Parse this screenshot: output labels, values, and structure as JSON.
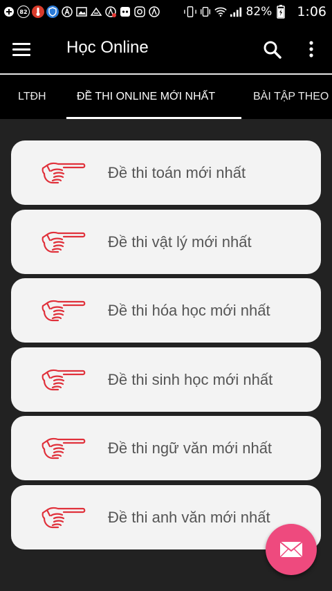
{
  "status_bar": {
    "notification_count": "82",
    "battery_percent": "82%",
    "time": "1:06",
    "icons_left": [
      "add-icon",
      "notification-count-icon",
      "thermometer-icon",
      "shield-icon",
      "app-a-icon",
      "image-icon",
      "mail-icon",
      "app-a-badge-icon",
      "gamepad-icon",
      "instagram-icon",
      "app-a2-icon"
    ],
    "icons_right": [
      "phone-rotate-icon",
      "vibrate-icon",
      "wifi-icon",
      "signal-icon",
      "battery-charging-icon"
    ]
  },
  "toolbar": {
    "title": "Học Online",
    "menu_icon": "hamburger-menu-icon",
    "search_icon": "search-icon",
    "overflow_icon": "more-vert-icon"
  },
  "tabs": [
    {
      "label": "LTĐH",
      "active": false
    },
    {
      "label": "ĐỀ THI ONLINE MỚI NHẤT",
      "active": true
    },
    {
      "label": "BÀI TẬP THEO",
      "active": false
    }
  ],
  "items": [
    {
      "label": "Đề thi toán mới nhất",
      "icon": "pointing-hand-icon"
    },
    {
      "label": "Đề thi vật lý mới nhất",
      "icon": "pointing-hand-icon"
    },
    {
      "label": "Đề thi hóa học mới nhất",
      "icon": "pointing-hand-icon"
    },
    {
      "label": "Đề thi sinh học mới nhất",
      "icon": "pointing-hand-icon"
    },
    {
      "label": "Đề thi ngữ văn mới nhất",
      "icon": "pointing-hand-icon"
    },
    {
      "label": "Đề thi anh văn mới nhất",
      "icon": "pointing-hand-icon"
    }
  ],
  "fab": {
    "icon": "mail-icon"
  },
  "colors": {
    "background": "#222222",
    "toolbar": "#000000",
    "card": "#f3f3f3",
    "hand_icon": "#e0303a",
    "fab": "#ee4a7e"
  }
}
